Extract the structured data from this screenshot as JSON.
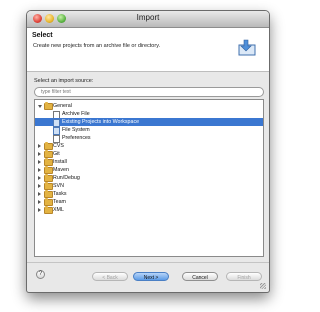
{
  "window": {
    "title": "Import"
  },
  "header": {
    "title": "Select",
    "description": "Create new projects from an archive file or directory."
  },
  "source_label": "Select an import source:",
  "filter": {
    "placeholder": "type filter text",
    "value": ""
  },
  "tree": {
    "selected": "Existing Projects into Workspace",
    "items": [
      {
        "label": "General",
        "level": 0,
        "expanded": true,
        "icon": "folder-icon"
      },
      {
        "label": "Archive File",
        "level": 1,
        "icon": "archive-file-icon"
      },
      {
        "label": "Existing Projects into Workspace",
        "level": 1,
        "icon": "project-icon"
      },
      {
        "label": "File System",
        "level": 1,
        "icon": "file-system-icon"
      },
      {
        "label": "Preferences",
        "level": 1,
        "icon": "preferences-icon"
      },
      {
        "label": "CVS",
        "level": 0,
        "expanded": false,
        "icon": "folder-icon"
      },
      {
        "label": "Git",
        "level": 0,
        "expanded": false,
        "icon": "folder-icon"
      },
      {
        "label": "Install",
        "level": 0,
        "expanded": false,
        "icon": "folder-icon"
      },
      {
        "label": "Maven",
        "level": 0,
        "expanded": false,
        "icon": "folder-icon"
      },
      {
        "label": "Run/Debug",
        "level": 0,
        "expanded": false,
        "icon": "folder-icon"
      },
      {
        "label": "SVN",
        "level": 0,
        "expanded": false,
        "icon": "folder-icon"
      },
      {
        "label": "Tasks",
        "level": 0,
        "expanded": false,
        "icon": "folder-icon"
      },
      {
        "label": "Team",
        "level": 0,
        "expanded": false,
        "icon": "folder-icon"
      },
      {
        "label": "XML",
        "level": 0,
        "expanded": false,
        "icon": "folder-icon"
      }
    ]
  },
  "buttons": {
    "help": "?",
    "back": "< Back",
    "next": "Next >",
    "cancel": "Cancel",
    "finish": "Finish"
  },
  "colors": {
    "selection": "#3b77d1",
    "folder": "#e3b342",
    "primary_button": "#5c9be6"
  }
}
